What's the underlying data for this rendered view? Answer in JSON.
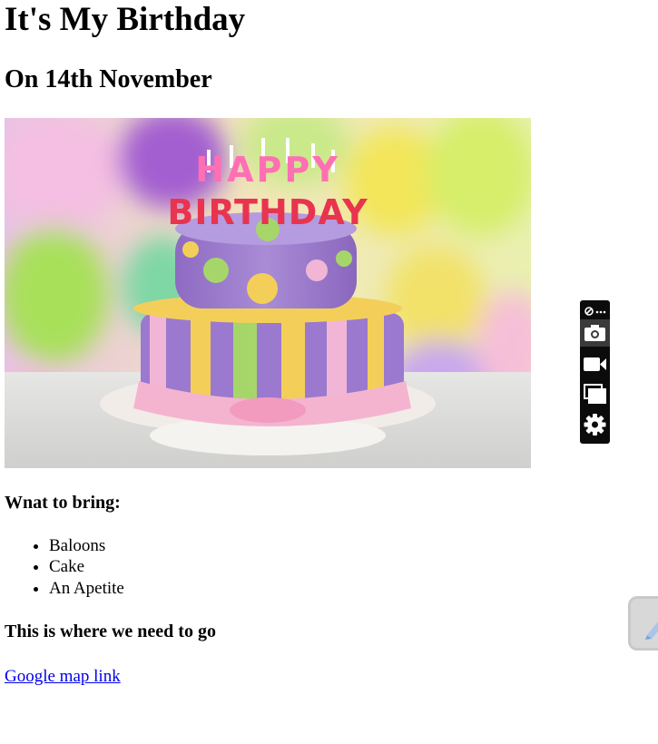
{
  "page": {
    "title": "It's My Birthday",
    "subtitle": "On 14th November",
    "image_alt": "Birthday cake",
    "cake_topper_text": "HAPPY BIRTHDAY",
    "bring_heading": "Wnat to bring:",
    "bring_items": [
      "Baloons",
      "Cake",
      "An Apetite"
    ],
    "location_heading": "This is where we need to go",
    "map_link_text": "Google map link"
  },
  "toolbar": {
    "icons": [
      "link-more-icon",
      "camera-icon",
      "video-icon",
      "window-stack-icon",
      "gear-icon"
    ],
    "background": "#0b0b0b",
    "active_item_background": "#3a3a3a"
  },
  "colors": {
    "link": "#0000ee",
    "text": "#000000"
  }
}
